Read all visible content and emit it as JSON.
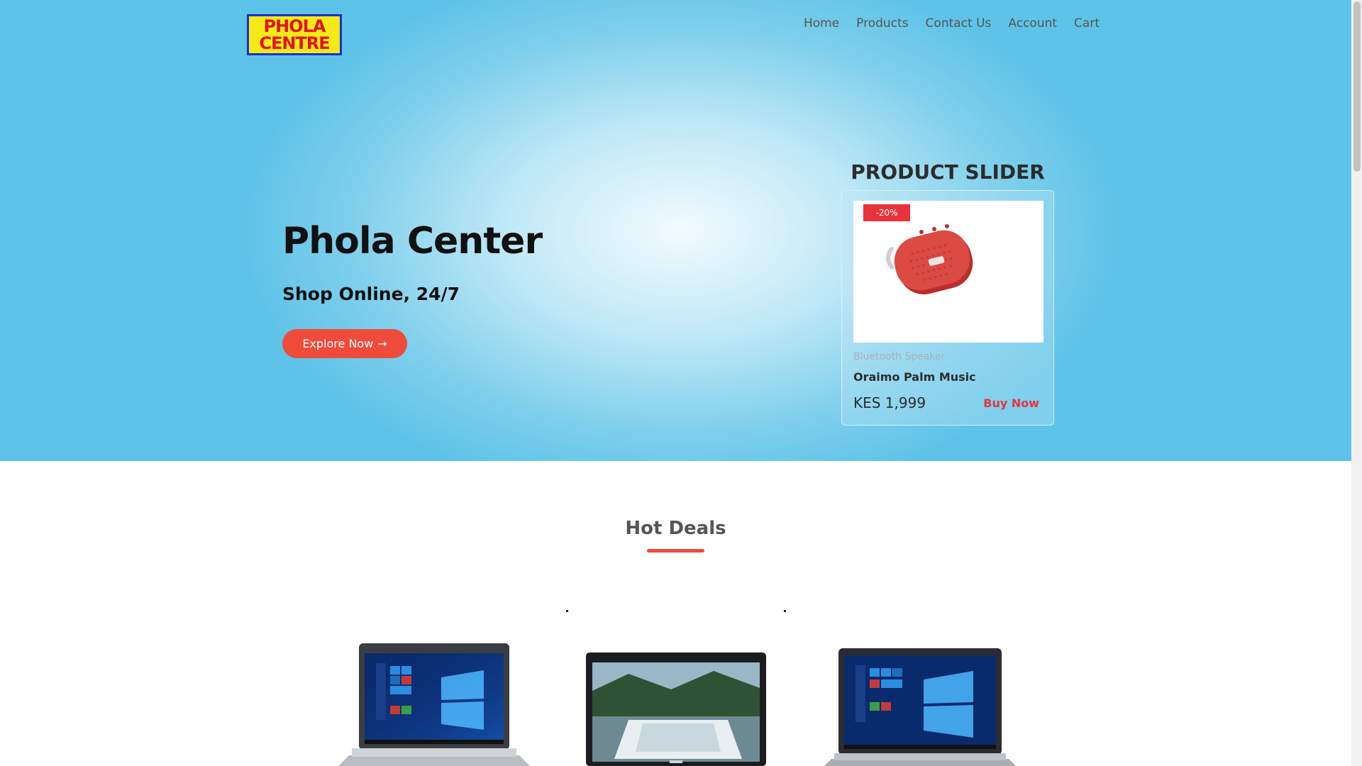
{
  "logo": {
    "line1": "PHOLA",
    "line2": "CENTRE"
  },
  "nav": {
    "items": [
      "Home",
      "Products",
      "Contact Us",
      "Account",
      "Cart"
    ]
  },
  "hero": {
    "title": "Phola Center",
    "subtitle": "Shop Online, 24/7",
    "cta_label": "Explore Now",
    "cta_arrow": "→"
  },
  "slider": {
    "title": "PRODUCT SLIDER",
    "badge": "-20%",
    "category": "Bluetooth Speaker",
    "product_name": "Oraimo Palm Music",
    "price": "KES 1,999",
    "buy_label": "Buy Now"
  },
  "hot_deals": {
    "title": "Hot Deals"
  },
  "products": [
    {
      "icon": "hp-laptop-image"
    },
    {
      "icon": "dell-laptop-image"
    },
    {
      "icon": "hp-elitebook-laptop-image"
    }
  ],
  "colors": {
    "accent": "#ef4b3a",
    "badge": "#e8333a",
    "hero_blue": "#5ec3e8",
    "logo_yellow": "#f5ea16",
    "logo_red": "#e0151b",
    "logo_border": "#1a2fd6"
  }
}
